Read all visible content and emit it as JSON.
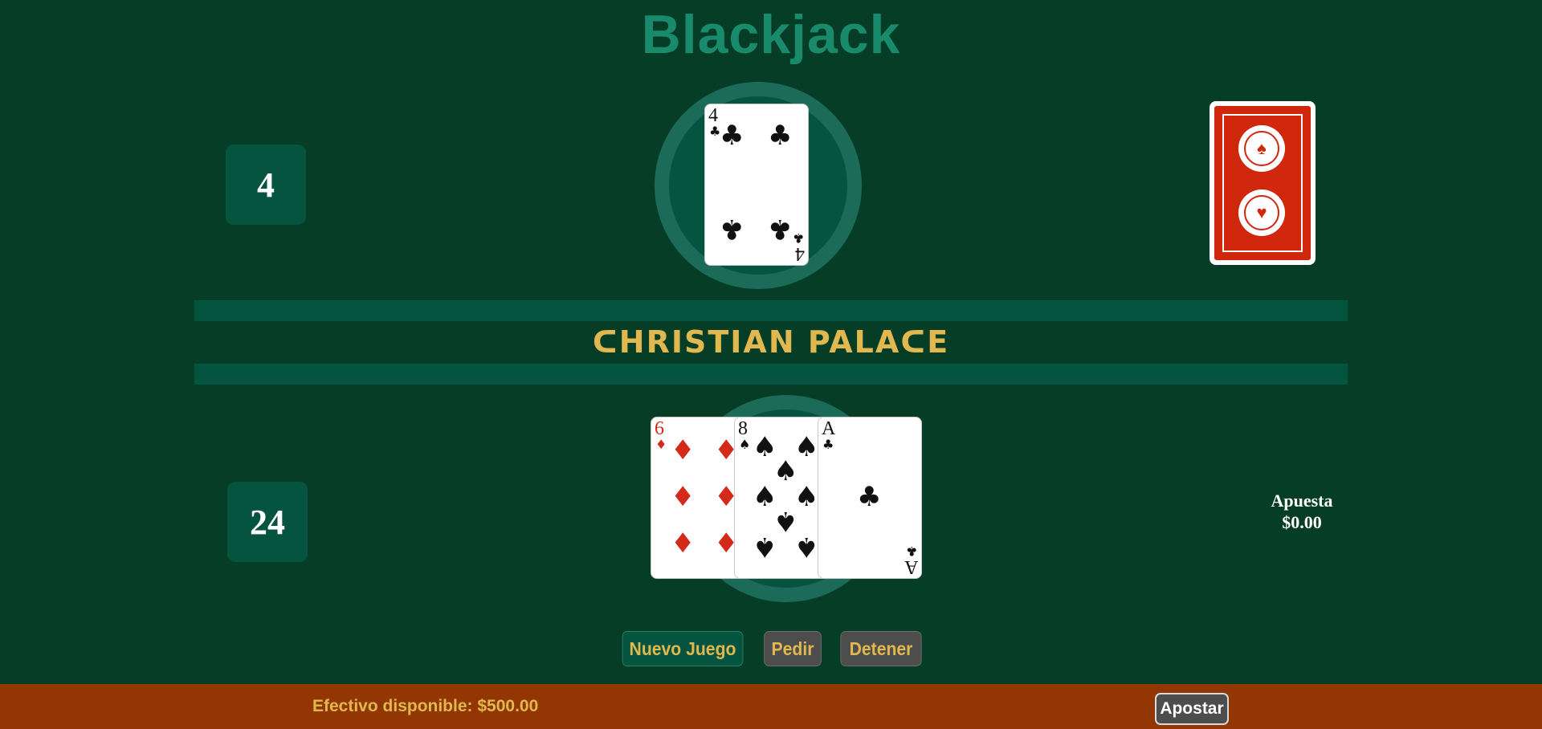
{
  "title": "Blackjack",
  "dealer": {
    "score": "4",
    "card": {
      "rank": "4",
      "suit": "♣",
      "color": "black"
    }
  },
  "player": {
    "score": "24",
    "cards": [
      {
        "rank": "6",
        "suit": "♦",
        "color": "red"
      },
      {
        "rank": "8",
        "suit": "♠",
        "color": "black"
      },
      {
        "rank": "A",
        "suit": "♣",
        "color": "black"
      }
    ]
  },
  "deck": {
    "back_color": "#d0270d",
    "emblem_icon": "spade-medallion-icon"
  },
  "brand": "ᑕHRISTIAN PALAᑕE",
  "bet": {
    "label": "Apuesta",
    "amount": "$0.00"
  },
  "controls": {
    "new_game": "Nuevo Juego",
    "hit": "Pedir",
    "stand": "Detener"
  },
  "footer": {
    "cash_label": "Efectivo disponible: $500.00",
    "bet_button": "Apostar"
  },
  "colors": {
    "table": "#063d27",
    "accent": "#e0b84f",
    "footer": "#923703"
  }
}
